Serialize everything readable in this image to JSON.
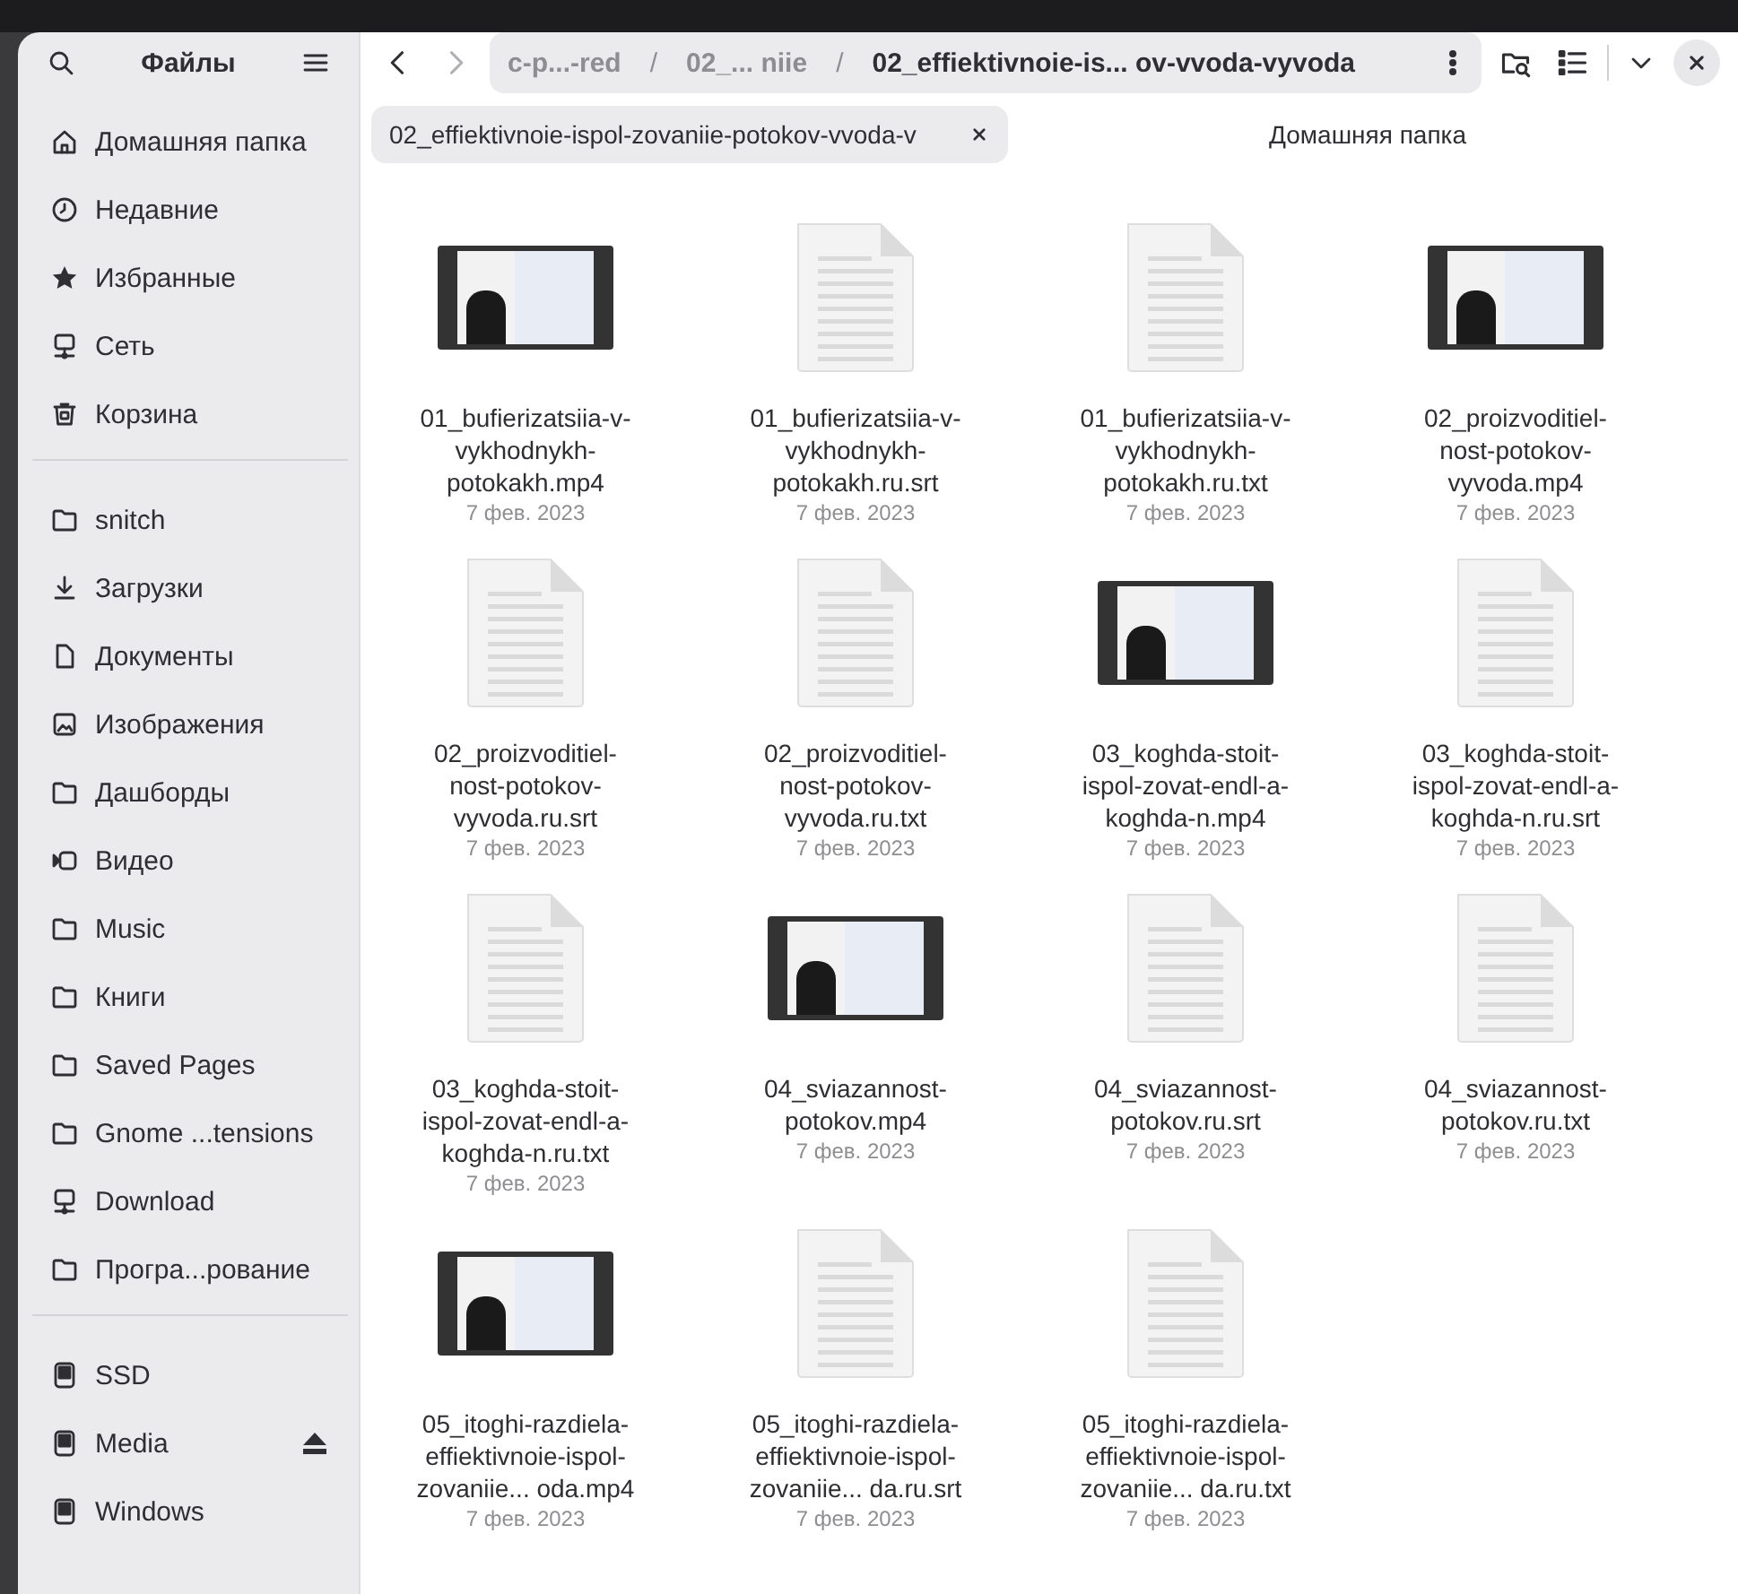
{
  "sidebar": {
    "title": "Файлы",
    "places": [
      {
        "kind": "home",
        "label": "Домашняя папка",
        "selected": false
      },
      {
        "kind": "clock",
        "label": "Недавние",
        "selected": false
      },
      {
        "kind": "star",
        "label": "Избранные",
        "selected": false
      },
      {
        "kind": "network",
        "label": "Сеть",
        "selected": false
      },
      {
        "kind": "trash",
        "label": "Корзина",
        "selected": false
      }
    ],
    "bookmarks": [
      {
        "kind": "folder",
        "label": "snitch",
        "selected": false
      },
      {
        "kind": "download",
        "label": "Загрузки",
        "selected": false
      },
      {
        "kind": "document",
        "label": "Документы",
        "selected": false
      },
      {
        "kind": "image",
        "label": "Изображения",
        "selected": false
      },
      {
        "kind": "folder",
        "label": "Дашборды",
        "selected": false
      },
      {
        "kind": "video",
        "label": "Видео",
        "selected": false
      },
      {
        "kind": "folder",
        "label": "Music",
        "selected": false
      },
      {
        "kind": "folder",
        "label": "Книги",
        "selected": false
      },
      {
        "kind": "folder",
        "label": "Saved Pages",
        "selected": false
      },
      {
        "kind": "folder",
        "label": "Gnome ...tensions",
        "selected": false
      },
      {
        "kind": "network",
        "label": "Download",
        "selected": false
      },
      {
        "kind": "folder",
        "label": "Програ...рование",
        "selected": false
      }
    ],
    "devices": [
      {
        "kind": "drive",
        "label": "SSD",
        "eject": false,
        "selected": false
      },
      {
        "kind": "drive",
        "label": "Media",
        "eject": true,
        "selected": false
      },
      {
        "kind": "drive",
        "label": "Windows",
        "eject": false,
        "selected": false
      }
    ]
  },
  "path_bar": {
    "segments": [
      {
        "label": "c-p...-red",
        "current": false
      },
      {
        "label": "02_... niie",
        "current": false
      },
      {
        "label": "02_effiektivnoie-is... ov-vvoda-vyvoda",
        "current": true
      }
    ],
    "separator": "/"
  },
  "tabs": [
    {
      "label": "02_effiektivnoie-ispol-zovaniie-potokov-vvoda-v",
      "selected": true,
      "closable": true
    },
    {
      "label": "Домашняя папка",
      "selected": false,
      "closable": false
    }
  ],
  "files": [
    {
      "kind": "video",
      "name": "01_bufierizatsiia-v-vykhodnykh-potokakh.mp4",
      "date": "7 фев. 2023"
    },
    {
      "kind": "text",
      "name": "01_bufierizatsiia-v-vykhodnykh-potokakh.ru.srt",
      "date": "7 фев. 2023"
    },
    {
      "kind": "text",
      "name": "01_bufierizatsiia-v-vykhodnykh-potokakh.ru.txt",
      "date": "7 фев. 2023"
    },
    {
      "kind": "video",
      "name": "02_proizvoditiel-nost-potokov-vyvoda.mp4",
      "date": "7 фев. 2023"
    },
    {
      "kind": "text",
      "name": "02_proizvoditiel-nost-potokov-vyvoda.ru.srt",
      "date": "7 фев. 2023"
    },
    {
      "kind": "text",
      "name": "02_proizvoditiel-nost-potokov-vyvoda.ru.txt",
      "date": "7 фев. 2023"
    },
    {
      "kind": "video",
      "name": "03_koghda-stoit-ispol-zovat-endl-a-koghda-n.mp4",
      "date": "7 фев. 2023"
    },
    {
      "kind": "text",
      "name": "03_koghda-stoit-ispol-zovat-endl-a-koghda-n.ru.srt",
      "date": "7 фев. 2023"
    },
    {
      "kind": "text",
      "name": "03_koghda-stoit-ispol-zovat-endl-a-koghda-n.ru.txt",
      "date": "7 фев. 2023"
    },
    {
      "kind": "video",
      "name": "04_sviazannost-potokov.mp4",
      "date": "7 фев. 2023"
    },
    {
      "kind": "text",
      "name": "04_sviazannost-potokov.ru.srt",
      "date": "7 фев. 2023"
    },
    {
      "kind": "text",
      "name": "04_sviazannost-potokov.ru.txt",
      "date": "7 фев. 2023"
    },
    {
      "kind": "video",
      "name": "05_itoghi-razdiela-effiektivnoie-ispol-zovaniie... oda.mp4",
      "date": "7 фев. 2023"
    },
    {
      "kind": "text",
      "name": "05_itoghi-razdiela-effiektivnoie-ispol-zovaniie... da.ru.srt",
      "date": "7 фев. 2023"
    },
    {
      "kind": "text",
      "name": "05_itoghi-razdiela-effiektivnoie-ispol-zovaniie... da.ru.txt",
      "date": "7 фев. 2023"
    }
  ]
}
